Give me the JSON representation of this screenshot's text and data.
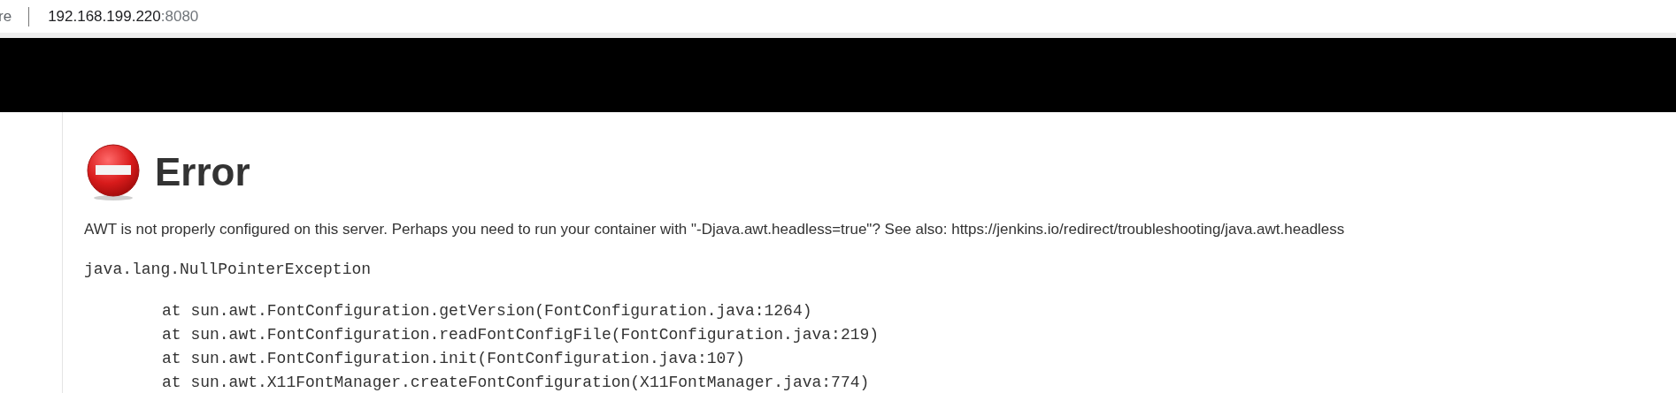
{
  "address_bar": {
    "security_label": "re",
    "host": "192.168.199.220",
    "port": ":8080"
  },
  "error": {
    "title": "Error",
    "message": "AWT is not properly configured on this server. Perhaps you need to run your container with \"-Djava.awt.headless=true\"? See also: https://jenkins.io/redirect/troubleshooting/java.awt.headless",
    "stack_trace": {
      "exception": "java.lang.NullPointerException",
      "frames": [
        "at sun.awt.FontConfiguration.getVersion(FontConfiguration.java:1264)",
        "at sun.awt.FontConfiguration.readFontConfigFile(FontConfiguration.java:219)",
        "at sun.awt.FontConfiguration.init(FontConfiguration.java:107)",
        "at sun.awt.X11FontManager.createFontConfiguration(X11FontManager.java:774)"
      ]
    }
  }
}
